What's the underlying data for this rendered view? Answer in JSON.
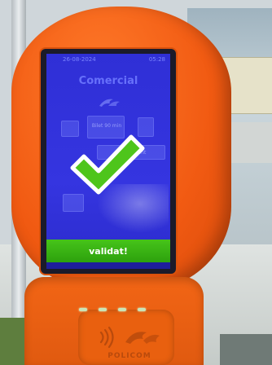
{
  "screen": {
    "date": "26-08-2024",
    "time": "05:28",
    "title": "Comercial",
    "ghost_buttons": [
      "",
      "Bilet 90 min",
      "",
      "Abonament",
      ""
    ],
    "validation_status": "validat!"
  },
  "device": {
    "brand": "POLICOM",
    "nfc_icon": "contactless-icon",
    "status_icon": "checkmark-icon",
    "led_count": 4
  },
  "colors": {
    "device_orange": "#f15a12",
    "screen_blue": "#3535e0",
    "success_green": "#3bb514",
    "check_green": "#4ec51b"
  }
}
